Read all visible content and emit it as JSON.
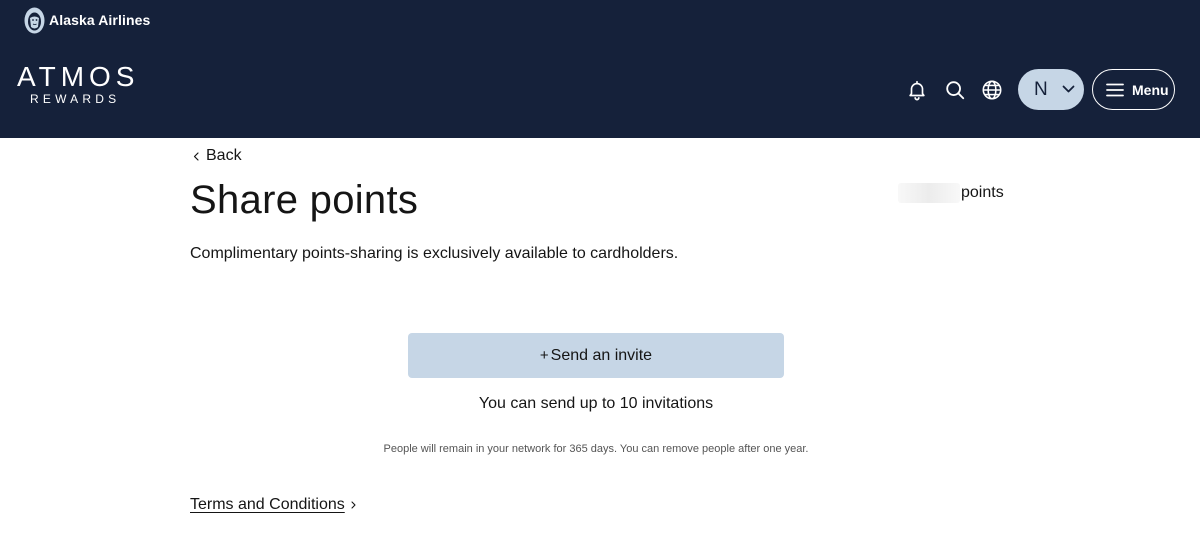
{
  "header": {
    "brand_name": "Alaska Airlines",
    "program_name": "ATMOS",
    "program_sub": "REWARDS",
    "account_initial": "N",
    "menu_label": "Menu",
    "icons": [
      "bell-icon",
      "search-icon",
      "globe-icon",
      "chevron-down-icon",
      "hamburger-icon"
    ]
  },
  "colors": {
    "header_bg": "#15213a",
    "accent_light": "#c6d6e6",
    "text": "#151515"
  },
  "main": {
    "back_label": "Back",
    "title": "Share points",
    "points_label": "points",
    "subtitle": "Complimentary points-sharing is exclusively available to cardholders.",
    "invite_button": {
      "plus": "+",
      "label": "Send an invite"
    },
    "limit_text": "You can send up to 10 invitations",
    "network_note": "People will remain in your network for 365 days. You can remove people after one year.",
    "terms_label": "Terms and Conditions"
  }
}
